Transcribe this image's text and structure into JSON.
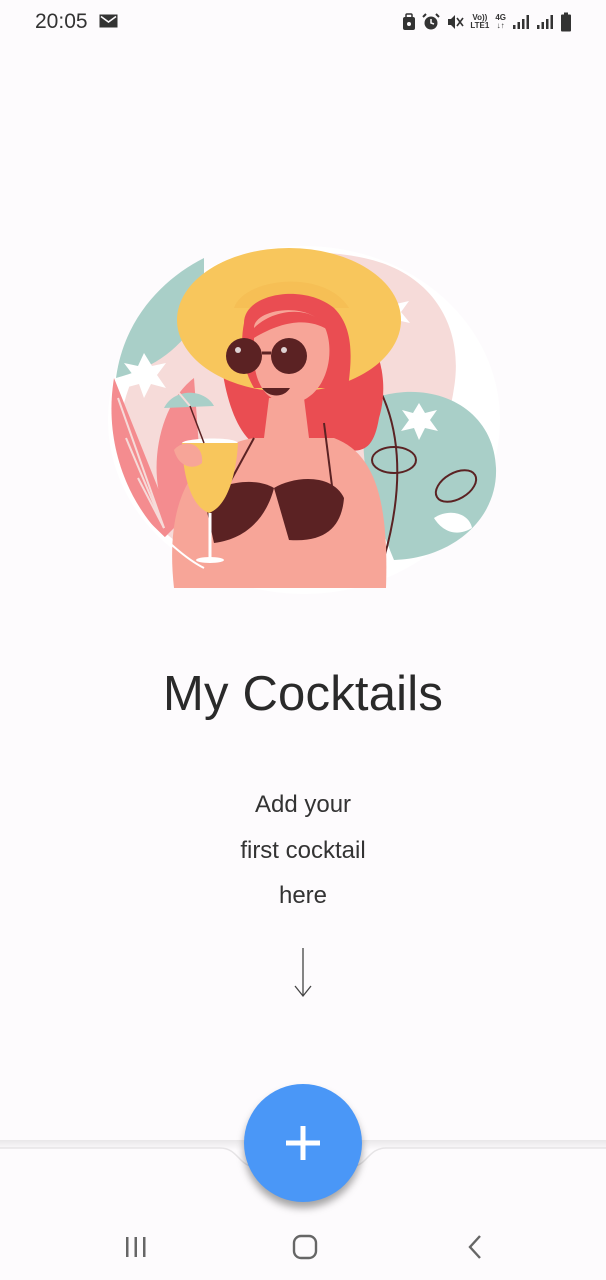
{
  "status_bar": {
    "time": "20:05",
    "icons": [
      "mail-icon",
      "lock-icon",
      "alarm-icon",
      "mute-icon",
      "volte-icon",
      "4g-icon",
      "signal-icon",
      "signal-icon",
      "battery-icon"
    ],
    "volte_top": "Vo))",
    "volte_bottom": "LTE1",
    "network_label": "4G"
  },
  "illustration": {
    "description_icon": "woman-with-cocktail-illustration",
    "colors": {
      "hat": "#f8c65c",
      "hair": "#ea4d52",
      "skin": "#f7a598",
      "bikini": "#5b2223",
      "leaf": "#a9cfc8",
      "pink_bg": "#f6dbd9"
    }
  },
  "main": {
    "title": "My Cocktails",
    "subtitle_lines": [
      "Add your",
      "first cocktail",
      "here"
    ]
  },
  "fab": {
    "icon": "plus-icon",
    "color": "#4a97f7"
  },
  "nav": {
    "recents_icon": "recents-icon",
    "home_icon": "home-icon",
    "back_icon": "back-icon"
  }
}
